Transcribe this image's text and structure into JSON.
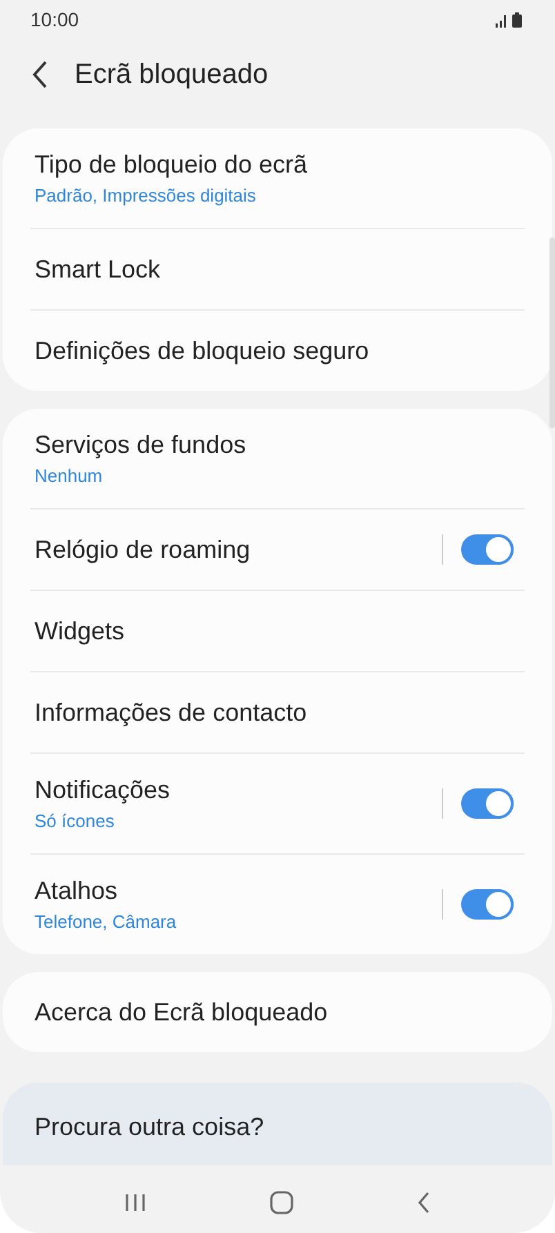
{
  "status_bar": {
    "time": "10:00"
  },
  "header": {
    "title": "Ecrã bloqueado"
  },
  "groups": [
    {
      "items": [
        {
          "kind": "link",
          "title": "Tipo de bloqueio do ecrã",
          "subtitle": "Padrão, Impressões digitais"
        },
        {
          "kind": "link",
          "title": "Smart Lock"
        },
        {
          "kind": "link",
          "title": "Definições de bloqueio seguro"
        }
      ]
    },
    {
      "items": [
        {
          "kind": "link",
          "title": "Serviços de fundos",
          "subtitle": "Nenhum"
        },
        {
          "kind": "toggle",
          "title": "Relógio de roaming",
          "on": true
        },
        {
          "kind": "link",
          "title": "Widgets"
        },
        {
          "kind": "link",
          "title": "Informações de contacto"
        },
        {
          "kind": "toggle",
          "title": "Notificações",
          "subtitle": "Só ícones",
          "on": true
        },
        {
          "kind": "toggle",
          "title": "Atalhos",
          "subtitle": "Telefone, Câmara",
          "on": true
        }
      ]
    },
    {
      "items": [
        {
          "kind": "link",
          "title": "Acerca do Ecrã bloqueado"
        }
      ]
    }
  ],
  "suggestion": {
    "title": "Procura outra coisa?"
  }
}
